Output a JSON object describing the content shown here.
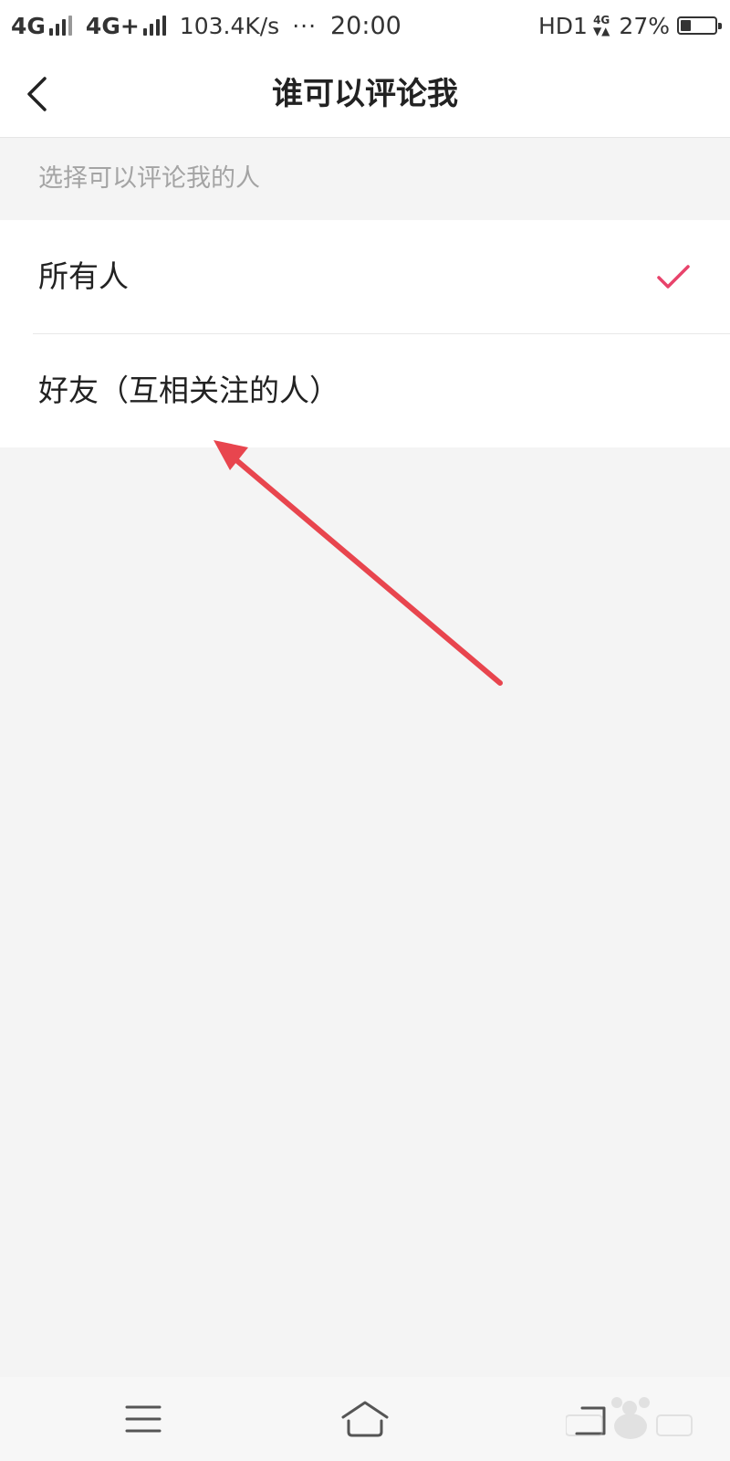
{
  "status_bar": {
    "network_1": "4G",
    "network_2": "4G+",
    "speed": "103.4K/s",
    "dots": "···",
    "time": "20:00",
    "hd": "HD1",
    "small_network": "4G",
    "battery_percent": "27%",
    "battery_level": 0.27
  },
  "nav": {
    "title": "谁可以评论我"
  },
  "section": {
    "header": "选择可以评论我的人"
  },
  "options": [
    {
      "label": "所有人",
      "selected": true
    },
    {
      "label": "好友（互相关注的人）",
      "selected": false
    }
  ],
  "colors": {
    "accent": "#e8436b",
    "annotation": "#e8454e",
    "background": "#f4f4f4"
  },
  "icons": {
    "back": "chevron-left-icon",
    "check": "check-icon",
    "menu": "menu-icon",
    "home": "home-icon",
    "recent": "back-nav-icon"
  }
}
